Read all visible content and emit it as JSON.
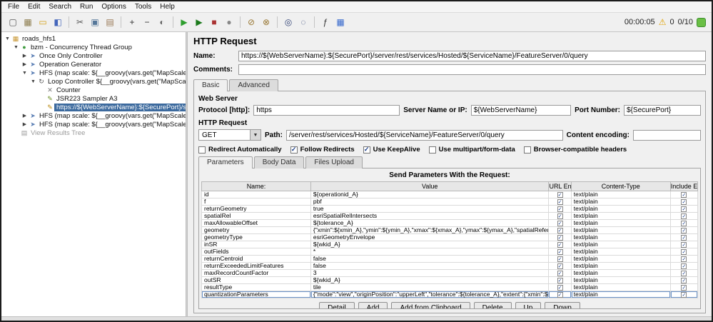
{
  "glyphs": {
    "check": "✓",
    "expander_open": "▼",
    "expander_closed": "▶",
    "dropdown": "▼"
  },
  "menu_bar": {
    "items": [
      "File",
      "Edit",
      "Search",
      "Run",
      "Options",
      "Tools",
      "Help"
    ]
  },
  "toolbar": {
    "icons": [
      {
        "name": "new-file-icon",
        "glyph": "▢",
        "color": "#555555"
      },
      {
        "name": "templates-icon",
        "glyph": "▦",
        "color": "#8a7a4a"
      },
      {
        "name": "open-file-icon",
        "glyph": "▭",
        "color": "#d4a017"
      },
      {
        "name": "save-icon",
        "glyph": "◧",
        "color": "#4466bb"
      },
      {
        "sep": true
      },
      {
        "name": "cut-icon",
        "glyph": "✂",
        "color": "#555555"
      },
      {
        "name": "copy-icon",
        "glyph": "▣",
        "color": "#557799"
      },
      {
        "name": "paste-icon",
        "glyph": "▤",
        "color": "#997755"
      },
      {
        "sep": true
      },
      {
        "name": "expand-all-icon",
        "glyph": "+",
        "color": "#333333"
      },
      {
        "name": "collapse-all-icon",
        "glyph": "−",
        "color": "#333333"
      },
      {
        "name": "toggle-icon",
        "glyph": "◐",
        "color": "#666666"
      },
      {
        "sep": true
      },
      {
        "name": "start-icon",
        "glyph": "▶",
        "color": "#2e9e2e"
      },
      {
        "name": "start-no-pauses-icon",
        "glyph": "▶",
        "color": "#1c7a1c"
      },
      {
        "name": "stop-icon",
        "glyph": "■",
        "color": "#aa3333"
      },
      {
        "name": "shutdown-icon",
        "glyph": "●",
        "color": "#888888"
      },
      {
        "sep": true
      },
      {
        "name": "clear-icon",
        "glyph": "⊘",
        "color": "#997733"
      },
      {
        "name": "clear-all-icon",
        "glyph": "⊗",
        "color": "#997733"
      },
      {
        "sep": true
      },
      {
        "name": "search-icon",
        "glyph": "◎",
        "color": "#334477"
      },
      {
        "name": "reset-search-icon",
        "glyph": "◌",
        "color": "#334477"
      },
      {
        "sep": true
      },
      {
        "name": "function-helper-icon",
        "glyph": "ƒ",
        "color": "#333333"
      },
      {
        "name": "help-grid-icon",
        "glyph": "▦",
        "color": "#3366cc"
      }
    ],
    "elapsed_time": "00:00:05",
    "warning_glyph": "⚠",
    "warning_count": "0",
    "thread_indicator": "0/10"
  },
  "tree": {
    "items": [
      {
        "id": "test-plan",
        "label": "roads_hfs1",
        "level": 0,
        "icon": "test-plan-icon",
        "glyph": "▦",
        "color": "#c89632",
        "expander": "open"
      },
      {
        "id": "concurrency-thread-group",
        "label": "bzm - Concurrency Thread Group",
        "level": 1,
        "icon": "thread-group-icon",
        "glyph": "●",
        "color": "#3f9c3f",
        "expander": "open"
      },
      {
        "id": "once-only-controller",
        "label": "Once Only Controller",
        "level": 2,
        "icon": "controller-icon",
        "glyph": "➤",
        "color": "#5b7fb5",
        "expander": "closed"
      },
      {
        "id": "operation-generator",
        "label": "Operation Generator",
        "level": 2,
        "icon": "controller-icon",
        "glyph": "➤",
        "color": "#5b7fb5",
        "expander": "closed"
      },
      {
        "id": "hfs-map-scale-a",
        "label": "HFS (map scale: ${__groovy(vars.get(\"MapScale_A\"))})",
        "level": 2,
        "icon": "controller-icon",
        "glyph": "➤",
        "color": "#5b7fb5",
        "expander": "open"
      },
      {
        "id": "loop-controller-a",
        "label": "Loop Controller ${__groovy(vars.get(\"MapScale_A\"))}",
        "level": 3,
        "icon": "loop-controller-icon",
        "glyph": "↻",
        "color": "#555555",
        "expander": "open"
      },
      {
        "id": "counter",
        "label": "Counter",
        "level": 4,
        "icon": "counter-icon",
        "glyph": "✕",
        "color": "#777777"
      },
      {
        "id": "jsr223-sampler-a3",
        "label": "JSR223 Sampler A3",
        "level": 4,
        "icon": "jsr223-sampler-icon",
        "glyph": "✎",
        "color": "#6b8e23"
      },
      {
        "id": "http-request-sampler",
        "label": "https://${WebServerName}:${SecurePort}/server/rest/services/Ho",
        "level": 4,
        "icon": "http-sampler-icon",
        "glyph": "✎",
        "color": "#b8860b",
        "selected": true
      },
      {
        "id": "hfs-map-scale-b",
        "label": "HFS (map scale: ${__groovy(vars.get(\"MapScale_B\"))})",
        "level": 2,
        "icon": "controller-icon",
        "glyph": "➤",
        "color": "#5b7fb5",
        "expander": "closed"
      },
      {
        "id": "hfs-map-scale-c",
        "label": "HFS (map scale: ${__groovy(vars.get(\"MapScale_C\"))})",
        "level": 2,
        "icon": "controller-icon",
        "glyph": "➤",
        "color": "#5b7fb5",
        "expander": "closed"
      },
      {
        "id": "view-results-tree",
        "label": "View Results Tree",
        "level": 1,
        "icon": "results-tree-icon",
        "glyph": "▤",
        "color": "#999999",
        "disabled": true
      }
    ]
  },
  "main": {
    "title": "HTTP Request",
    "name_label": "Name:",
    "name_value": "https://${WebServerName}:${SecurePort}/server/rest/services/Hosted/${ServiceName}/FeatureServer/0/query",
    "comments_label": "Comments:",
    "comments_value": "",
    "tabs": [
      {
        "label": "Basic",
        "selected": true
      },
      {
        "label": "Advanced",
        "selected": false
      }
    ],
    "web_server": {
      "heading": "Web Server",
      "protocol_label": "Protocol [http]:",
      "protocol_value": "https",
      "server_label": "Server Name or IP:",
      "server_value": "${WebServerName}",
      "port_label": "Port Number:",
      "port_value": "${SecurePort}"
    },
    "http_request": {
      "heading": "HTTP Request",
      "method_value": "GET",
      "path_label": "Path:",
      "path_value": "/server/rest/services/Hosted/${ServiceName}/FeatureServer/0/query",
      "content_encoding_label": "Content encoding:",
      "content_encoding_value": ""
    },
    "options": [
      {
        "label": "Redirect Automatically",
        "checked": false
      },
      {
        "label": "Follow Redirects",
        "checked": true
      },
      {
        "label": "Use KeepAlive",
        "checked": true
      },
      {
        "label": "Use multipart/form-data",
        "checked": false
      },
      {
        "label": "Browser-compatible headers",
        "checked": false
      }
    ],
    "param_tabs": [
      {
        "label": "Parameters",
        "selected": true
      },
      {
        "label": "Body Data",
        "selected": false
      },
      {
        "label": "Files Upload",
        "selected": false
      }
    ],
    "params_table": {
      "caption": "Send Parameters With the Request:",
      "columns": [
        "Name:",
        "Value",
        "URL En...",
        "Content-Type",
        "Include E..."
      ],
      "rows": [
        {
          "name": "id",
          "value": "${operationid_A}",
          "url_encode": true,
          "content_type": "text/plain",
          "include_equals": true
        },
        {
          "name": "f",
          "value": "pbf",
          "url_encode": true,
          "content_type": "text/plain",
          "include_equals": true
        },
        {
          "name": "returnGeometry",
          "value": "true",
          "url_encode": true,
          "content_type": "text/plain",
          "include_equals": true
        },
        {
          "name": "spatialRel",
          "value": "esriSpatialRelIntersects",
          "url_encode": true,
          "content_type": "text/plain",
          "include_equals": true
        },
        {
          "name": "maxAllowableOffset",
          "value": "${tolerance_A}",
          "url_encode": true,
          "content_type": "text/plain",
          "include_equals": true
        },
        {
          "name": "geometry",
          "value": "{\"xmin\":${xmin_A},\"ymin\":${ymin_A},\"xmax\":${xmax_A},\"ymax\":${ymax_A},\"spatialReference\":{\"wkid\":${wkid_A},\"latestWkid\":${lat...",
          "url_encode": true,
          "content_type": "text/plain",
          "include_equals": true
        },
        {
          "name": "geometryType",
          "value": "esriGeometryEnvelope",
          "url_encode": true,
          "content_type": "text/plain",
          "include_equals": true
        },
        {
          "name": "inSR",
          "value": "${wkid_A}",
          "url_encode": true,
          "content_type": "text/plain",
          "include_equals": true
        },
        {
          "name": "outFields",
          "value": "*",
          "url_encode": true,
          "content_type": "text/plain",
          "include_equals": true
        },
        {
          "name": "returnCentroid",
          "value": "false",
          "url_encode": true,
          "content_type": "text/plain",
          "include_equals": true
        },
        {
          "name": "returnExceededLimitFeatures",
          "value": "false",
          "url_encode": true,
          "content_type": "text/plain",
          "include_equals": true
        },
        {
          "name": "maxRecordCountFactor",
          "value": "3",
          "url_encode": true,
          "content_type": "text/plain",
          "include_equals": true
        },
        {
          "name": "outSR",
          "value": "${wkid_A}",
          "url_encode": true,
          "content_type": "text/plain",
          "include_equals": true
        },
        {
          "name": "resultType",
          "value": "tile",
          "url_encode": true,
          "content_type": "text/plain",
          "include_equals": true
        },
        {
          "name": "quantizationParameters",
          "value": "{\"mode\":\"view\",\"originPosition\":\"upperLeft\",\"tolerance\":${tolerance_A},\"extent\":{\"xmin\":${xmin_A},\"ymin\":${ymin_A},\"xmax\":${xma...",
          "url_encode": true,
          "content_type": "text/plain",
          "include_equals": true,
          "selected": true
        }
      ]
    },
    "buttons": [
      "Detail",
      "Add",
      "Add from Clipboard",
      "Delete",
      "Up",
      "Down"
    ]
  }
}
